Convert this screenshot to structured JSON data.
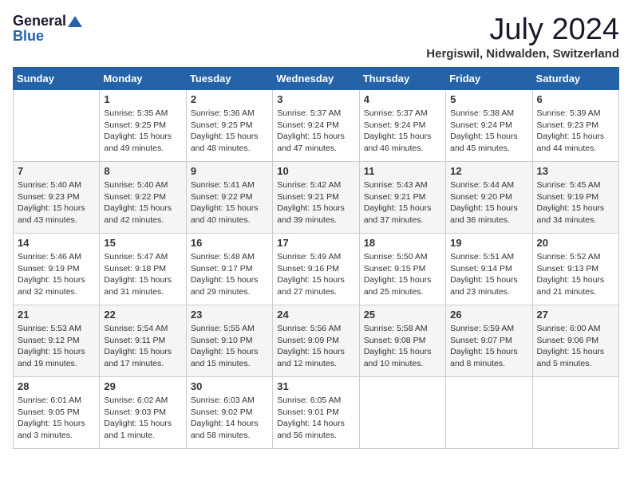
{
  "logo": {
    "general": "General",
    "blue": "Blue"
  },
  "title": "July 2024",
  "location": "Hergiswil, Nidwalden, Switzerland",
  "headers": [
    "Sunday",
    "Monday",
    "Tuesday",
    "Wednesday",
    "Thursday",
    "Friday",
    "Saturday"
  ],
  "weeks": [
    [
      {
        "day": "",
        "sunrise": "",
        "sunset": "",
        "daylight": ""
      },
      {
        "day": "1",
        "sunrise": "Sunrise: 5:35 AM",
        "sunset": "Sunset: 9:25 PM",
        "daylight": "Daylight: 15 hours and 49 minutes."
      },
      {
        "day": "2",
        "sunrise": "Sunrise: 5:36 AM",
        "sunset": "Sunset: 9:25 PM",
        "daylight": "Daylight: 15 hours and 48 minutes."
      },
      {
        "day": "3",
        "sunrise": "Sunrise: 5:37 AM",
        "sunset": "Sunset: 9:24 PM",
        "daylight": "Daylight: 15 hours and 47 minutes."
      },
      {
        "day": "4",
        "sunrise": "Sunrise: 5:37 AM",
        "sunset": "Sunset: 9:24 PM",
        "daylight": "Daylight: 15 hours and 46 minutes."
      },
      {
        "day": "5",
        "sunrise": "Sunrise: 5:38 AM",
        "sunset": "Sunset: 9:24 PM",
        "daylight": "Daylight: 15 hours and 45 minutes."
      },
      {
        "day": "6",
        "sunrise": "Sunrise: 5:39 AM",
        "sunset": "Sunset: 9:23 PM",
        "daylight": "Daylight: 15 hours and 44 minutes."
      }
    ],
    [
      {
        "day": "7",
        "sunrise": "Sunrise: 5:40 AM",
        "sunset": "Sunset: 9:23 PM",
        "daylight": "Daylight: 15 hours and 43 minutes."
      },
      {
        "day": "8",
        "sunrise": "Sunrise: 5:40 AM",
        "sunset": "Sunset: 9:22 PM",
        "daylight": "Daylight: 15 hours and 42 minutes."
      },
      {
        "day": "9",
        "sunrise": "Sunrise: 5:41 AM",
        "sunset": "Sunset: 9:22 PM",
        "daylight": "Daylight: 15 hours and 40 minutes."
      },
      {
        "day": "10",
        "sunrise": "Sunrise: 5:42 AM",
        "sunset": "Sunset: 9:21 PM",
        "daylight": "Daylight: 15 hours and 39 minutes."
      },
      {
        "day": "11",
        "sunrise": "Sunrise: 5:43 AM",
        "sunset": "Sunset: 9:21 PM",
        "daylight": "Daylight: 15 hours and 37 minutes."
      },
      {
        "day": "12",
        "sunrise": "Sunrise: 5:44 AM",
        "sunset": "Sunset: 9:20 PM",
        "daylight": "Daylight: 15 hours and 36 minutes."
      },
      {
        "day": "13",
        "sunrise": "Sunrise: 5:45 AM",
        "sunset": "Sunset: 9:19 PM",
        "daylight": "Daylight: 15 hours and 34 minutes."
      }
    ],
    [
      {
        "day": "14",
        "sunrise": "Sunrise: 5:46 AM",
        "sunset": "Sunset: 9:19 PM",
        "daylight": "Daylight: 15 hours and 32 minutes."
      },
      {
        "day": "15",
        "sunrise": "Sunrise: 5:47 AM",
        "sunset": "Sunset: 9:18 PM",
        "daylight": "Daylight: 15 hours and 31 minutes."
      },
      {
        "day": "16",
        "sunrise": "Sunrise: 5:48 AM",
        "sunset": "Sunset: 9:17 PM",
        "daylight": "Daylight: 15 hours and 29 minutes."
      },
      {
        "day": "17",
        "sunrise": "Sunrise: 5:49 AM",
        "sunset": "Sunset: 9:16 PM",
        "daylight": "Daylight: 15 hours and 27 minutes."
      },
      {
        "day": "18",
        "sunrise": "Sunrise: 5:50 AM",
        "sunset": "Sunset: 9:15 PM",
        "daylight": "Daylight: 15 hours and 25 minutes."
      },
      {
        "day": "19",
        "sunrise": "Sunrise: 5:51 AM",
        "sunset": "Sunset: 9:14 PM",
        "daylight": "Daylight: 15 hours and 23 minutes."
      },
      {
        "day": "20",
        "sunrise": "Sunrise: 5:52 AM",
        "sunset": "Sunset: 9:13 PM",
        "daylight": "Daylight: 15 hours and 21 minutes."
      }
    ],
    [
      {
        "day": "21",
        "sunrise": "Sunrise: 5:53 AM",
        "sunset": "Sunset: 9:12 PM",
        "daylight": "Daylight: 15 hours and 19 minutes."
      },
      {
        "day": "22",
        "sunrise": "Sunrise: 5:54 AM",
        "sunset": "Sunset: 9:11 PM",
        "daylight": "Daylight: 15 hours and 17 minutes."
      },
      {
        "day": "23",
        "sunrise": "Sunrise: 5:55 AM",
        "sunset": "Sunset: 9:10 PM",
        "daylight": "Daylight: 15 hours and 15 minutes."
      },
      {
        "day": "24",
        "sunrise": "Sunrise: 5:56 AM",
        "sunset": "Sunset: 9:09 PM",
        "daylight": "Daylight: 15 hours and 12 minutes."
      },
      {
        "day": "25",
        "sunrise": "Sunrise: 5:58 AM",
        "sunset": "Sunset: 9:08 PM",
        "daylight": "Daylight: 15 hours and 10 minutes."
      },
      {
        "day": "26",
        "sunrise": "Sunrise: 5:59 AM",
        "sunset": "Sunset: 9:07 PM",
        "daylight": "Daylight: 15 hours and 8 minutes."
      },
      {
        "day": "27",
        "sunrise": "Sunrise: 6:00 AM",
        "sunset": "Sunset: 9:06 PM",
        "daylight": "Daylight: 15 hours and 5 minutes."
      }
    ],
    [
      {
        "day": "28",
        "sunrise": "Sunrise: 6:01 AM",
        "sunset": "Sunset: 9:05 PM",
        "daylight": "Daylight: 15 hours and 3 minutes."
      },
      {
        "day": "29",
        "sunrise": "Sunrise: 6:02 AM",
        "sunset": "Sunset: 9:03 PM",
        "daylight": "Daylight: 15 hours and 1 minute."
      },
      {
        "day": "30",
        "sunrise": "Sunrise: 6:03 AM",
        "sunset": "Sunset: 9:02 PM",
        "daylight": "Daylight: 14 hours and 58 minutes."
      },
      {
        "day": "31",
        "sunrise": "Sunrise: 6:05 AM",
        "sunset": "Sunset: 9:01 PM",
        "daylight": "Daylight: 14 hours and 56 minutes."
      },
      {
        "day": "",
        "sunrise": "",
        "sunset": "",
        "daylight": ""
      },
      {
        "day": "",
        "sunrise": "",
        "sunset": "",
        "daylight": ""
      },
      {
        "day": "",
        "sunrise": "",
        "sunset": "",
        "daylight": ""
      }
    ]
  ]
}
